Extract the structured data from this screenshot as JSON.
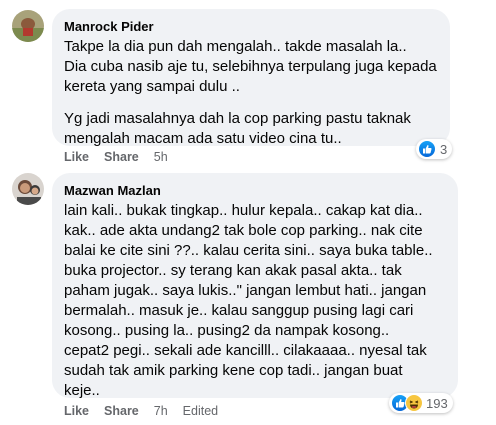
{
  "comments": [
    {
      "author": "Manrock Pider",
      "paragraphs": [
        "Takpe la dia pun dah mengalah.. takde masalah la..\nDia cuba nasib aje tu, selebihnya terpulang juga kepada\nkereta yang sampai dulu ..",
        "Yg jadi masalahnya dah la cop parking pastu taknak\nmengalah macam ada satu video cina tu.."
      ],
      "actions": {
        "like": "Like",
        "share": "Share",
        "time": "5h"
      },
      "reaction_count": "3"
    },
    {
      "author": "Mazwan Mazlan",
      "paragraphs": [
        "lain kali.. bukak tingkap.. hulur kepala.. cakap kat dia..\nkak.. ade akta undang2 tak bole cop parking.. nak cite\nbalai ke cite sini ??.. kalau cerita sini.. saya buka table..\nbuka projector.. sy terang kan akak pasal akta.. tak\npaham jugak.. saya lukis..\" jangan lembut hati.. jangan\nbermalah.. masuk je.. kalau sanggup pusing lagi cari\nkosong.. pusing la.. pusing2 da nampak kosong..\ncepat2 pegi.. sekali ade kancilll.. cilakaaaa.. nyesal tak\nsudah tak amik parking kene cop tadi.. jangan buat\nkeje.."
      ],
      "actions": {
        "like": "Like",
        "share": "Share",
        "time": "7h",
        "edited": "Edited"
      },
      "reaction_count": "193"
    }
  ],
  "colors": {
    "bubble": "#f0f2f5",
    "meta_text": "#65676b",
    "like_blue": "#1877f2",
    "haha_yellow": "#f7c640"
  },
  "icons": [
    "like-reaction-icon",
    "haha-reaction-icon"
  ]
}
